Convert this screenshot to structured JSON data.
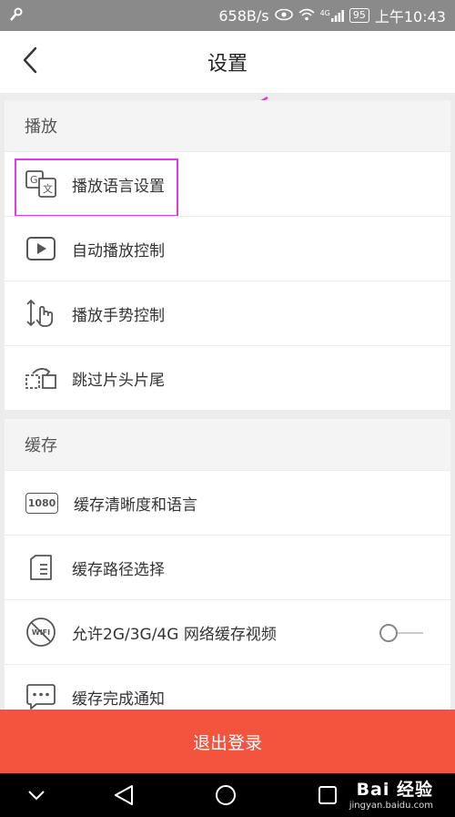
{
  "status_bar": {
    "net_speed": "658B/s",
    "signal_badge": "4G",
    "battery": "95",
    "time": "上午10:43",
    "icons": [
      "wrench-icon",
      "eye-icon",
      "wifi-icon",
      "signal-icon",
      "battery-icon"
    ]
  },
  "header": {
    "title": "设置",
    "back_icon": "chevron-left-icon"
  },
  "sections": {
    "playback": {
      "title": "播放",
      "items": [
        {
          "label": "播放语言设置",
          "icon": "translate-icon"
        },
        {
          "label": "自动播放控制",
          "icon": "play-icon"
        },
        {
          "label": "播放手势控制",
          "icon": "gesture-icon"
        },
        {
          "label": "跳过片头片尾",
          "icon": "skip-icon"
        }
      ]
    },
    "cache": {
      "title": "缓存",
      "items": [
        {
          "label": "缓存清晰度和语言",
          "icon": "hd-1080-icon",
          "icon_text": "1080"
        },
        {
          "label": "缓存路径选择",
          "icon": "sd-card-icon"
        },
        {
          "label": "允许2G/3G/4G 网络缓存视频",
          "icon": "no-wifi-icon",
          "icon_text": "WIFI",
          "toggle": "off"
        },
        {
          "label": "缓存完成通知",
          "icon": "message-icon"
        }
      ]
    }
  },
  "logout": {
    "label": "退出登录"
  },
  "watermark": {
    "logo": "Bai 经验",
    "url": "jingyan.baidu.com"
  },
  "colors": {
    "accent": "#f4543e",
    "annotation": "#e13be3",
    "status_bar": "#8a8a8a"
  }
}
